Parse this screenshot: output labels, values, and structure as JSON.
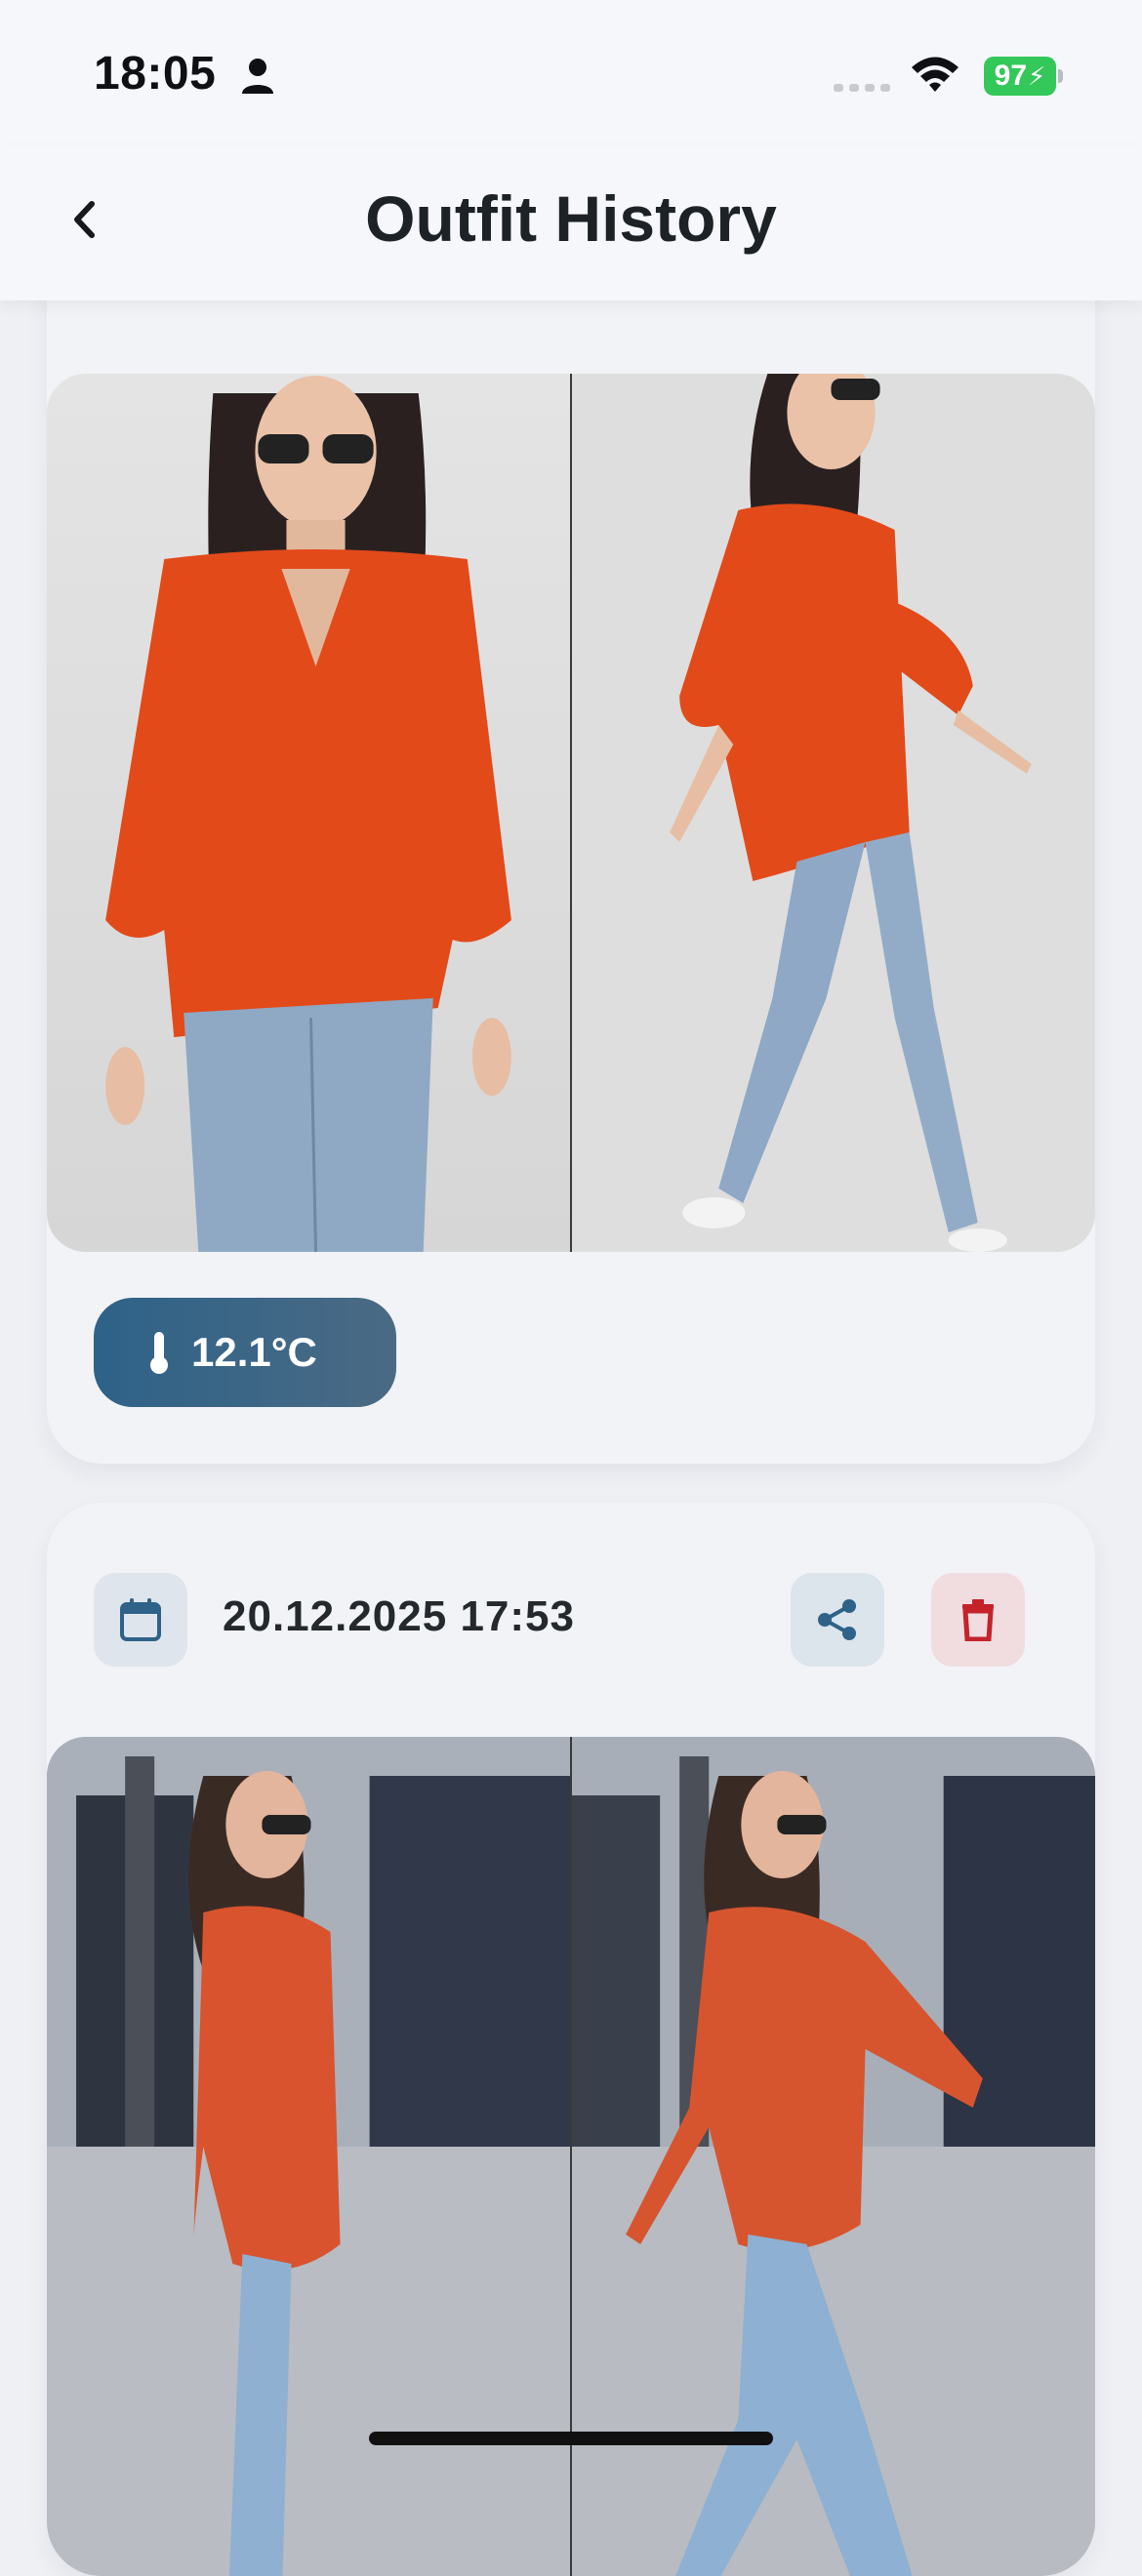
{
  "status_bar": {
    "time": "18:05",
    "battery": "97",
    "icons": [
      "person-icon",
      "cellular-signal-icon",
      "wifi-icon",
      "battery-charging-icon"
    ]
  },
  "header": {
    "title": "Outfit History",
    "back_icon": "chevron-left-icon"
  },
  "entries": [
    {
      "temperature": "12.1°C",
      "temperature_icon": "thermometer-icon",
      "photos": [
        "front-view-photo",
        "side-walking-photo"
      ]
    },
    {
      "date": "20.12.2025 17:53",
      "date_icon": "calendar-icon",
      "share_icon": "share-icon",
      "delete_icon": "trash-icon",
      "photos": [
        "street-walking-photo",
        "street-walking-photo-2"
      ]
    }
  ],
  "colors": {
    "accent": "#2e6288",
    "delete": "#c5222a",
    "background": "#eef0f4",
    "battery": "#34c759"
  }
}
